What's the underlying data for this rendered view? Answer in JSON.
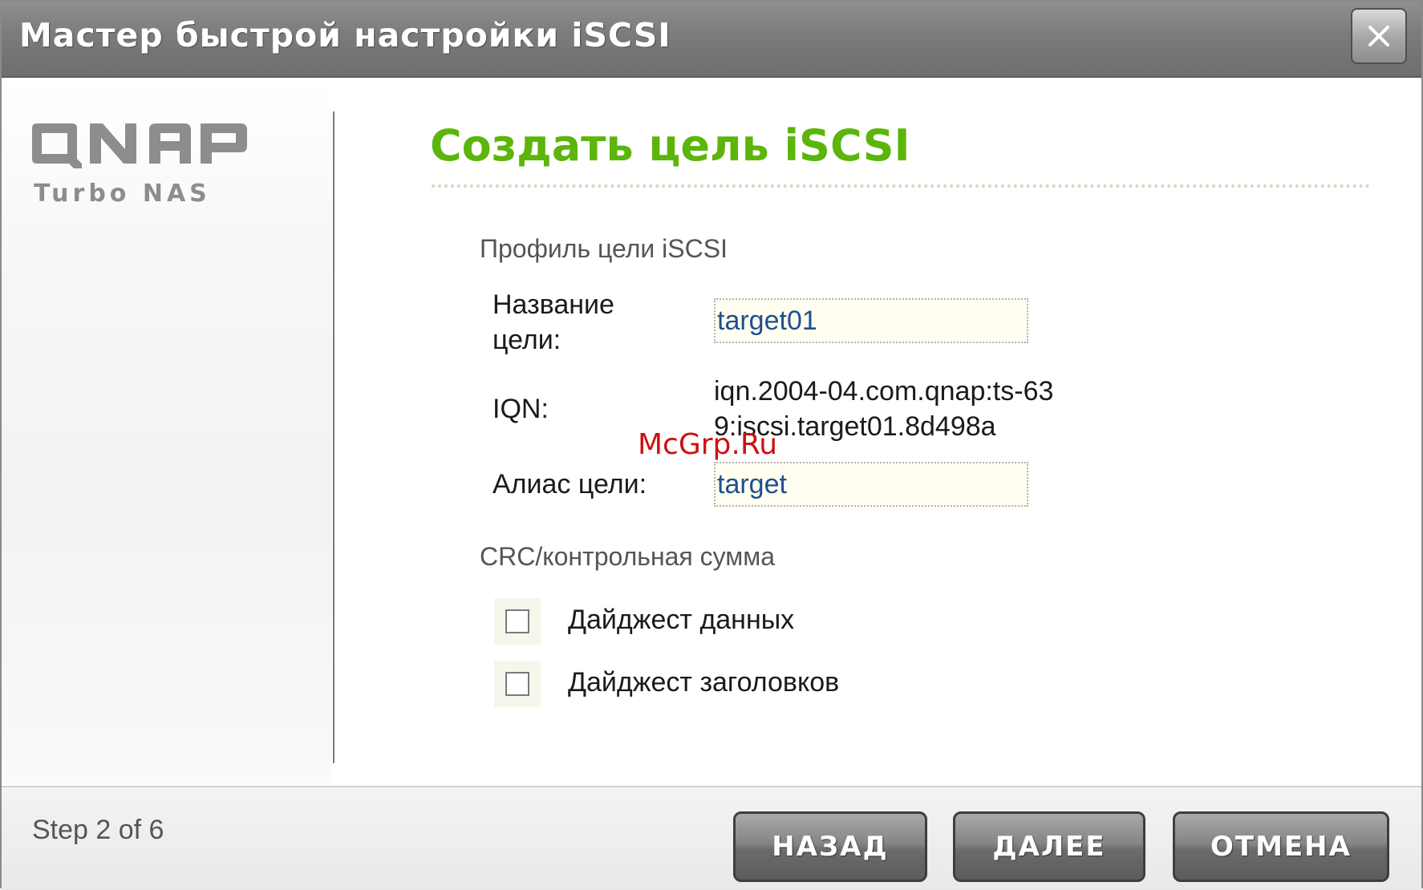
{
  "window": {
    "title": "Мастер быстрой настройки iSCSI",
    "close_icon": "close-icon"
  },
  "logo": {
    "main": "QNAP",
    "sub": "Turbo NAS"
  },
  "main": {
    "heading": "Создать цель iSCSI",
    "profile_section": "Профиль цели iSCSI",
    "target_name_label": "Название цели:",
    "target_name_value": "target01",
    "iqn_label": "IQN:",
    "iqn_value": "iqn.2004-04.com.qnap:ts-639:iscsi.target01.8d498a",
    "alias_label": "Алиас цели:",
    "alias_value": "target",
    "crc_section": "CRC/контрольная сумма",
    "data_digest_label": "Дайджест данных",
    "data_digest_checked": false,
    "header_digest_label": "Дайджест заголовков",
    "header_digest_checked": false
  },
  "footer": {
    "step": "Step 2 of 6",
    "back_label": "НАЗАД",
    "next_label": "ДАЛЕЕ",
    "cancel_label": "ОТМЕНА"
  },
  "watermark": "McGrp.Ru",
  "colors": {
    "heading_green": "#5cb50a",
    "input_text_blue": "#1e4f8f",
    "titlebar_gray": "#7b7b7b",
    "watermark_red": "#cc1111"
  }
}
